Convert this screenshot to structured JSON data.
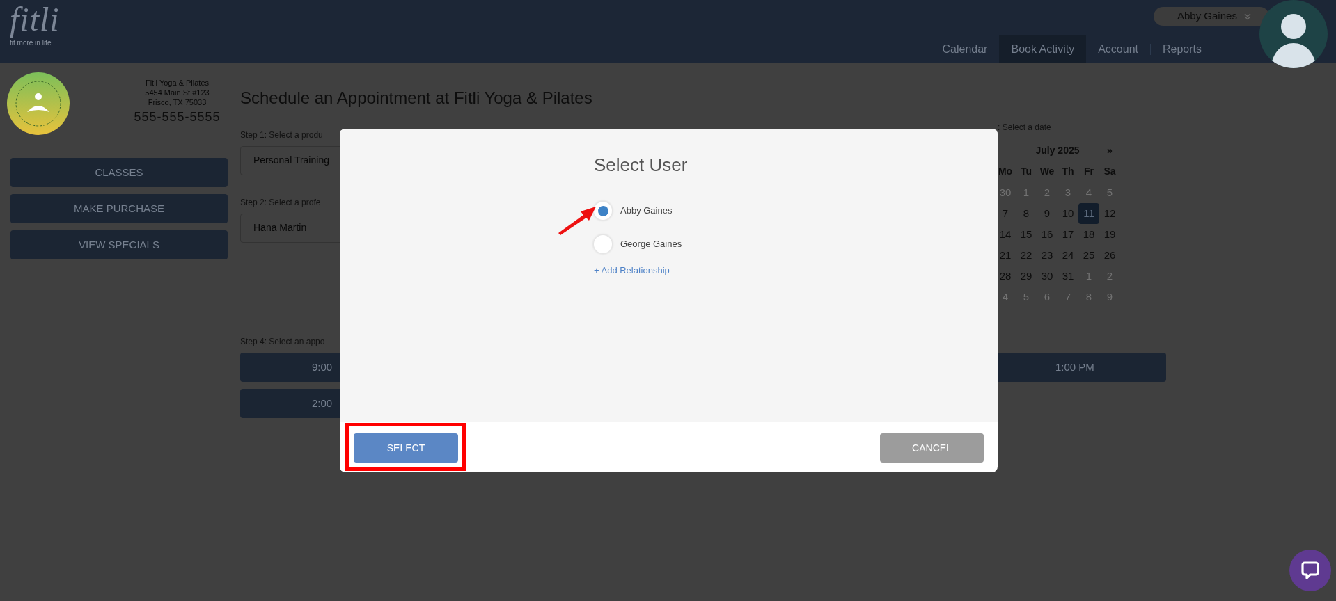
{
  "header": {
    "logo": "fitli",
    "tagline": "fit more in life",
    "user": {
      "name": "Abby Gaines"
    },
    "nav": [
      {
        "label": "Calendar",
        "selected": false
      },
      {
        "label": "Book Activity",
        "selected": true
      },
      {
        "label": "Account",
        "selected": false
      },
      {
        "label": "Reports",
        "selected": false
      }
    ]
  },
  "sidebar": {
    "studio": {
      "name": "Fitli Yoga & Pilates",
      "address_1": "5454 Main St #123",
      "address_2": "Frisco, TX 75033",
      "phone": "555-555-5555"
    },
    "buttons": [
      "CLASSES",
      "MAKE PURCHASE",
      "VIEW SPECIALS"
    ]
  },
  "page": {
    "title": "Schedule an Appointment at Fitli Yoga & Pilates",
    "steps": [
      {
        "label": "Step 1: Select a produ",
        "value": "Personal Training"
      },
      {
        "label": "Step 2: Select a profe",
        "value": "Hana Martin"
      }
    ],
    "calendar": {
      "label": ": Select a date",
      "month": "July 2025",
      "next": "»",
      "weekdays": [
        "Mo",
        "Tu",
        "We",
        "Th",
        "Fr",
        "Sa"
      ],
      "weeks": [
        [
          {
            "day": "30",
            "muted": true,
            "selected": false
          },
          {
            "day": "1",
            "muted": true,
            "selected": false
          },
          {
            "day": "2",
            "muted": true,
            "selected": false
          },
          {
            "day": "3",
            "muted": true,
            "selected": false
          },
          {
            "day": "4",
            "muted": true,
            "selected": false
          },
          {
            "day": "5",
            "muted": true,
            "selected": false
          }
        ],
        [
          {
            "day": "7",
            "muted": false,
            "selected": false
          },
          {
            "day": "8",
            "muted": false,
            "selected": false
          },
          {
            "day": "9",
            "muted": false,
            "selected": false
          },
          {
            "day": "10",
            "muted": false,
            "selected": false
          },
          {
            "day": "11",
            "muted": false,
            "selected": true
          },
          {
            "day": "12",
            "muted": false,
            "selected": false
          }
        ],
        [
          {
            "day": "14",
            "muted": false,
            "selected": false
          },
          {
            "day": "15",
            "muted": false,
            "selected": false
          },
          {
            "day": "16",
            "muted": false,
            "selected": false
          },
          {
            "day": "17",
            "muted": false,
            "selected": false
          },
          {
            "day": "18",
            "muted": false,
            "selected": false
          },
          {
            "day": "19",
            "muted": false,
            "selected": false
          }
        ],
        [
          {
            "day": "21",
            "muted": false,
            "selected": false
          },
          {
            "day": "22",
            "muted": false,
            "selected": false
          },
          {
            "day": "23",
            "muted": false,
            "selected": false
          },
          {
            "day": "24",
            "muted": false,
            "selected": false
          },
          {
            "day": "25",
            "muted": false,
            "selected": false
          },
          {
            "day": "26",
            "muted": false,
            "selected": false
          }
        ],
        [
          {
            "day": "28",
            "muted": false,
            "selected": false
          },
          {
            "day": "29",
            "muted": false,
            "selected": false
          },
          {
            "day": "30",
            "muted": false,
            "selected": false
          },
          {
            "day": "31",
            "muted": false,
            "selected": false
          },
          {
            "day": "1",
            "muted": true,
            "selected": false
          },
          {
            "day": "2",
            "muted": true,
            "selected": false
          }
        ],
        [
          {
            "day": "4",
            "muted": true,
            "selected": false
          },
          {
            "day": "5",
            "muted": true,
            "selected": false
          },
          {
            "day": "6",
            "muted": true,
            "selected": false
          },
          {
            "day": "7",
            "muted": true,
            "selected": false
          },
          {
            "day": "8",
            "muted": true,
            "selected": false
          },
          {
            "day": "9",
            "muted": true,
            "selected": false
          }
        ]
      ]
    },
    "step_4": {
      "label": "Step 4: Select an appo",
      "rows": [
        [
          "9:00",
          "1:00 PM"
        ],
        [
          "2:00"
        ]
      ]
    }
  },
  "modal": {
    "title": "Select User",
    "users": [
      {
        "name": "Abby Gaines",
        "selected": true
      },
      {
        "name": "George Gaines",
        "selected": false
      }
    ],
    "link": "+ Add Relationship",
    "primary_button": "SELECT",
    "secondary_button": "CANCEL"
  }
}
